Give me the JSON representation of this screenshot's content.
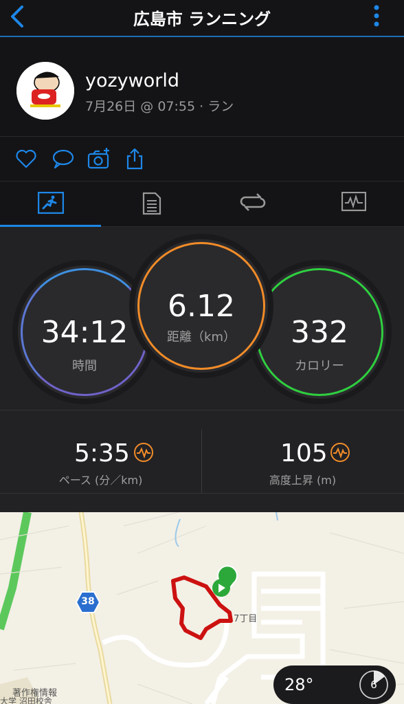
{
  "header": {
    "title": "広島市 ランニング"
  },
  "activity": {
    "username": "yozyworld",
    "subline": "7月26日 @ 07:55 · ラン"
  },
  "stats": {
    "time": {
      "value": "34:12",
      "label": "時間"
    },
    "distance": {
      "value": "6.12",
      "label": "距離（km）"
    },
    "calories": {
      "value": "332",
      "label": "カロリー"
    }
  },
  "metrics": {
    "pace": {
      "value": "5:35",
      "label": "ペース (分／km)"
    },
    "elevation": {
      "value": "105",
      "label": "高度上昇 (m)"
    }
  },
  "map": {
    "route_badge": "38",
    "label_chome": "7丁目",
    "label_copyright": "著作権情報",
    "label_school": "大学 沼田校舎",
    "temperature": "28°",
    "wind_speed": "6"
  },
  "colors": {
    "accent": "#1e87e8",
    "time_ring": "#6f63c9",
    "distance_ring": "#f28c28",
    "calories_ring": "#2fcf3f",
    "route": "#cc1111"
  }
}
